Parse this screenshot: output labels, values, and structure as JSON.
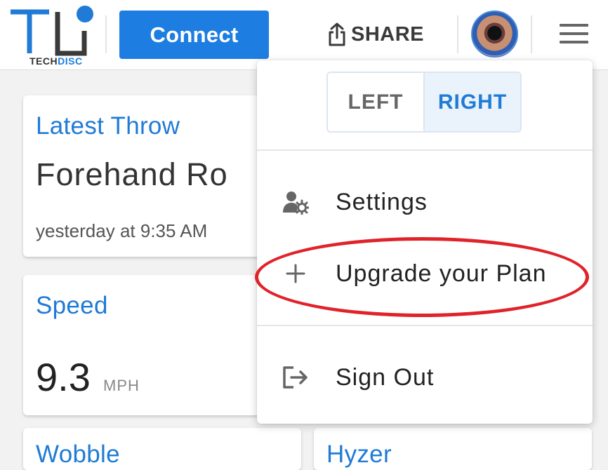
{
  "header": {
    "logo_wordmark_a": "TECH",
    "logo_wordmark_b": "DISC",
    "connect_label": "Connect",
    "share_label": "SHARE"
  },
  "cards": {
    "latest_throw": {
      "title": "Latest Throw",
      "throw_type": "Forehand Ro",
      "time": "yesterday at 9:35 AM"
    },
    "speed": {
      "title": "Speed",
      "value": "9.3",
      "unit": "MPH"
    },
    "bottom_left_title": "Wobble",
    "bottom_right_title": "Hyzer"
  },
  "menu": {
    "hand_toggle": {
      "left_label": "LEFT",
      "right_label": "RIGHT",
      "selected": "RIGHT"
    },
    "items": [
      {
        "label": "Settings",
        "icon": "user-gear-icon"
      },
      {
        "label": "Upgrade your Plan",
        "icon": "plus-icon"
      },
      {
        "label": "Sign Out",
        "icon": "sign-out-icon"
      }
    ]
  },
  "colors": {
    "brand_blue": "#1e7de0",
    "annotation_red": "#e0232a"
  }
}
